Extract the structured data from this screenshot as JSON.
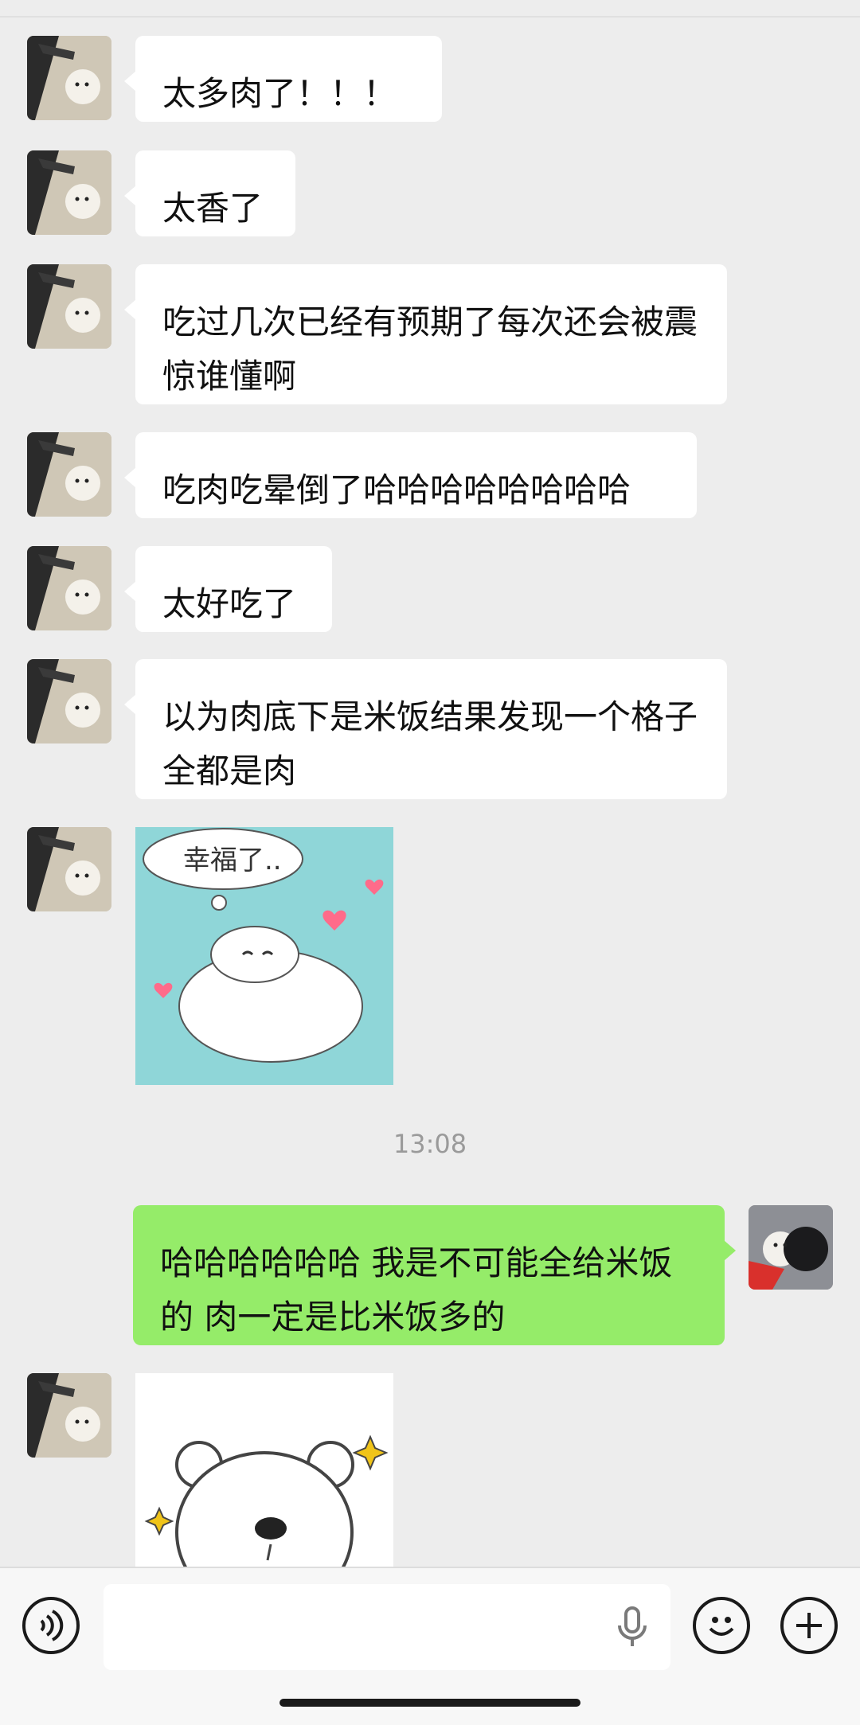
{
  "chat": {
    "messages": [
      {
        "side": "left",
        "type": "text",
        "text": "太多肉了！！！"
      },
      {
        "side": "left",
        "type": "text",
        "text": "太香了"
      },
      {
        "side": "left",
        "type": "text",
        "text": "吃过几次已经有预期了每次还会被震惊谁懂啊"
      },
      {
        "side": "left",
        "type": "text",
        "text": "吃肉吃晕倒了哈哈哈哈哈哈哈哈"
      },
      {
        "side": "left",
        "type": "text",
        "text": "太好吃了"
      },
      {
        "side": "left",
        "type": "text",
        "text": "以为肉底下是米饭结果发现一个格子全都是肉"
      },
      {
        "side": "left",
        "type": "sticker",
        "caption": "幸福了.."
      },
      {
        "side": "right",
        "type": "text",
        "text": "哈哈哈哈哈哈 我是不可能全给米饭的 肉一定是比米饭多的"
      },
      {
        "side": "left",
        "type": "sticker",
        "caption": ""
      }
    ],
    "timestamp": "13:08"
  },
  "input_bar": {
    "voice_icon": "voice-mode-icon",
    "mic_icon": "microphone-icon",
    "emoji_icon": "emoji-icon",
    "plus_icon": "plus-icon",
    "input_value": ""
  },
  "colors": {
    "background": "#ededed",
    "bubble_left": "#ffffff",
    "bubble_right": "#95ec69",
    "sticker_bg": "#8fd6d8"
  }
}
